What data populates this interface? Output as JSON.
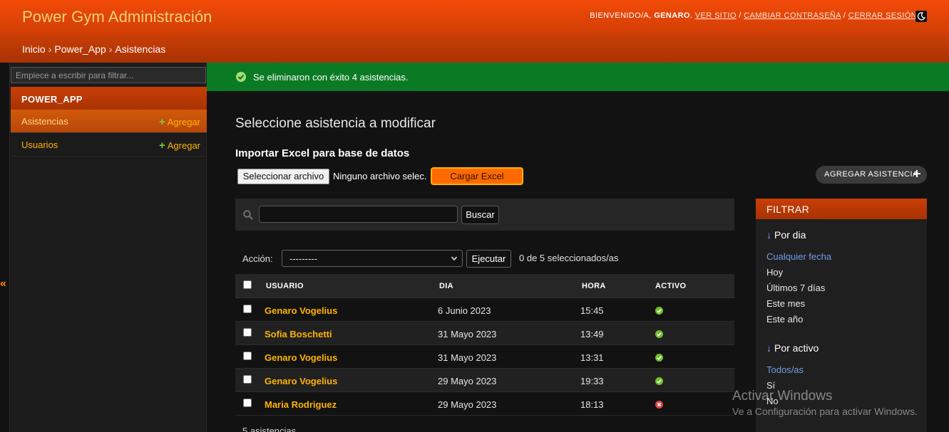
{
  "header": {
    "title": "Power Gym Administración",
    "welcome": "BIENVENIDO/A,",
    "username": "GENARO",
    "view_site": "VER SITIO",
    "change_password": "CAMBIAR CONTRASEÑA",
    "logout": "CERRAR SESIÓN",
    "theme_icon": "moon-icon"
  },
  "breadcrumbs": [
    "Inicio",
    "Power_App",
    "Asistencias"
  ],
  "sidebar": {
    "filter_placeholder": "Empiece a escribir para filtrar...",
    "app_label": "POWER_APP",
    "models": [
      {
        "name": "Asistencias",
        "add": "Agregar",
        "current": true
      },
      {
        "name": "Usuarios",
        "add": "Agregar",
        "current": false
      }
    ],
    "collapse_glyph": "«"
  },
  "message": {
    "text": "Se eliminaron con éxito 4 asistencias.",
    "icon": "success-icon"
  },
  "content": {
    "title": "Seleccione asistencia a modificar",
    "import_title": "Importar Excel para base de datos",
    "file_button": "Seleccionar archivo",
    "file_status": "Ninguno archivo selec.",
    "upload_button": "Cargar Excel",
    "add_button": "AGREGAR ASISTENCIA"
  },
  "search": {
    "value": "",
    "button": "Buscar"
  },
  "actions": {
    "label": "Acción:",
    "selected_option": "---------",
    "go_button": "Ejecutar",
    "counter": "0 de 5 seleccionados/as"
  },
  "table": {
    "columns": [
      "USUARIO",
      "DIA",
      "HORA",
      "ACTIVO"
    ],
    "rows": [
      {
        "usuario": "Genaro Vogelius",
        "dia": "6 Junio 2023",
        "hora": "15:45",
        "activo": true
      },
      {
        "usuario": "Sofia Boschetti",
        "dia": "31 Mayo 2023",
        "hora": "13:49",
        "activo": true
      },
      {
        "usuario": "Genaro Vogelius",
        "dia": "31 Mayo 2023",
        "hora": "13:31",
        "activo": true
      },
      {
        "usuario": "Genaro Vogelius",
        "dia": "29 Mayo 2023",
        "hora": "19:33",
        "activo": true
      },
      {
        "usuario": "Maria Rodriguez",
        "dia": "29 Mayo 2023",
        "hora": "18:13",
        "activo": false
      }
    ],
    "footer": "5 asistencias"
  },
  "filter": {
    "title": "FILTRAR",
    "groups": [
      {
        "heading": "Por dia",
        "items": [
          "Cualquier fecha",
          "Hoy",
          "Últimos 7 días",
          "Este mes",
          "Este año"
        ],
        "selected": 0
      },
      {
        "heading": "Por activo",
        "items": [
          "Todos/as",
          "Sí",
          "No"
        ],
        "selected": 0
      }
    ]
  },
  "watermark": {
    "title": "Activar Windows",
    "subtitle": "Ve a Configuración para activar Windows."
  },
  "colors": {
    "header": "#e84507",
    "accent": "#ffb300",
    "success_bar": "#0b7a24",
    "upload_button": "#ff6a00"
  }
}
